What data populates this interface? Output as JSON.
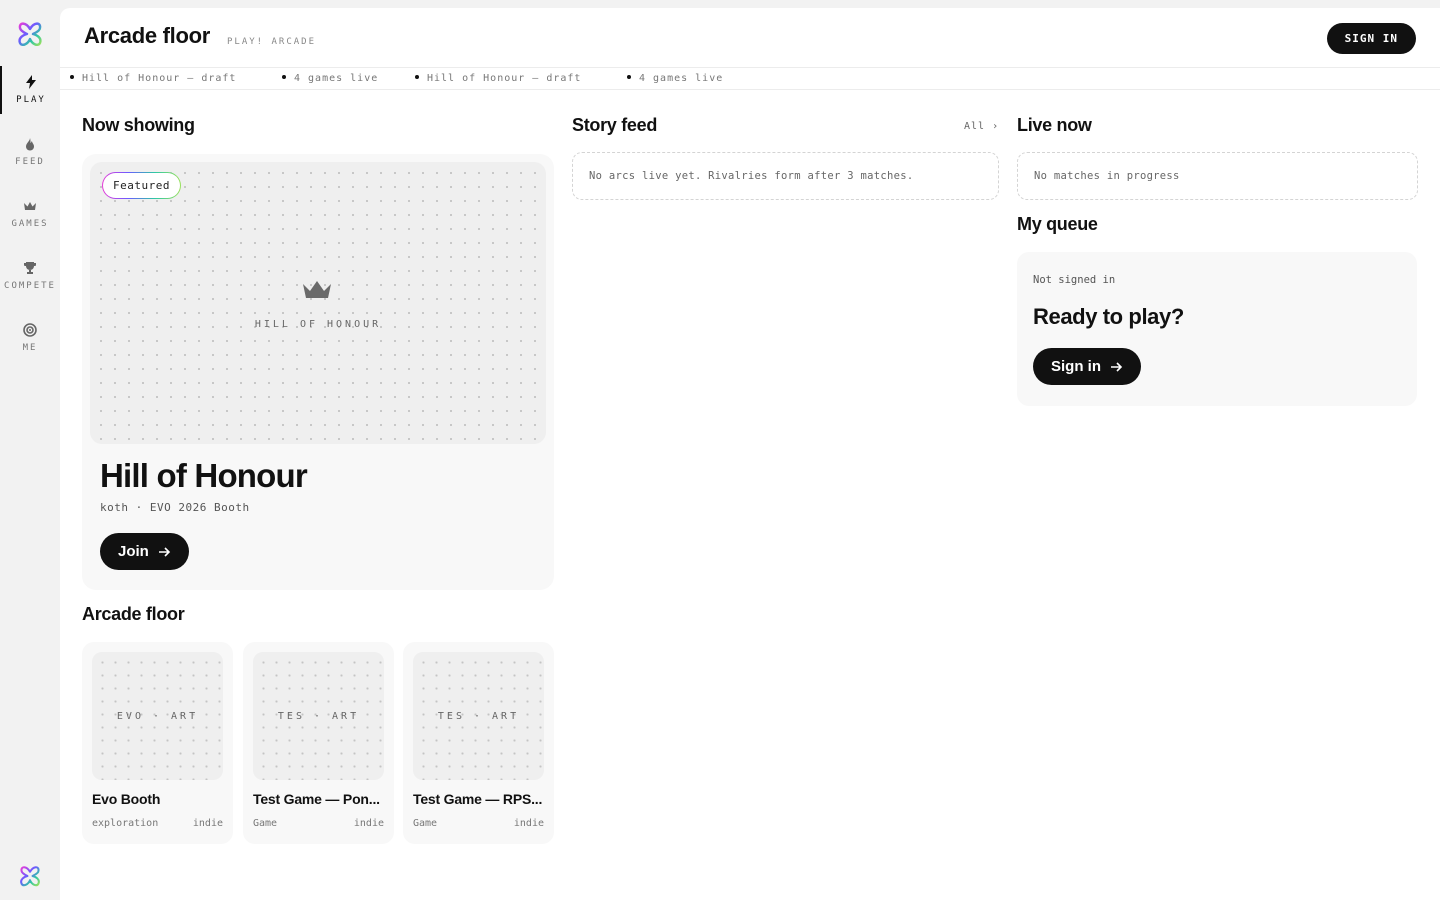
{
  "nav": {
    "items": [
      {
        "label": "PLAY",
        "icon": "bolt-icon"
      },
      {
        "label": "FEED",
        "icon": "flame-icon"
      },
      {
        "label": "GAMES",
        "icon": "crown-icon"
      },
      {
        "label": "COMPETE",
        "icon": "trophy-icon"
      },
      {
        "label": "ME",
        "icon": "target-icon"
      }
    ],
    "active": "PLAY"
  },
  "header": {
    "title": "Arcade floor",
    "subtitle": "PLAY! ARCADE",
    "sign_in": "SIGN IN"
  },
  "ticker": [
    "Hill of Honour – draft",
    "4 games live",
    "Hill of Honour – draft",
    "4 games live"
  ],
  "now_showing": {
    "title": "Now showing",
    "badge": "Featured",
    "art_label": "HILL OF HONOUR",
    "name": "Hill of Honour",
    "meta": "koth · EVO 2026 Booth",
    "join": "Join"
  },
  "arcade_floor": {
    "title": "Arcade floor",
    "games": [
      {
        "art_label": "EVO · ART",
        "name": "Evo Booth",
        "genre": "exploration",
        "tag": "indie"
      },
      {
        "art_label": "TES · ART",
        "name": "Test Game — Pon...",
        "genre": "Game",
        "tag": "indie"
      },
      {
        "art_label": "TES · ART",
        "name": "Test Game — RPS...",
        "genre": "Game",
        "tag": "indie"
      }
    ]
  },
  "story_feed": {
    "title": "Story feed",
    "all_link": "All ›",
    "empty": "No arcs live yet. Rivalries form after 3 matches."
  },
  "live_now": {
    "title": "Live now",
    "empty": "No matches in progress"
  },
  "my_queue": {
    "title": "My queue",
    "status": "Not signed in",
    "heading": "Ready to play?",
    "button": "Sign in"
  },
  "colors": {
    "accent": "#111111",
    "panel": "#ffffff",
    "sidebar": "#f2f2f2",
    "card": "#f8f8f8",
    "logo_gradient": [
      "#e83dd8",
      "#6a5cff",
      "#2fc7a5",
      "#9be15d"
    ]
  }
}
